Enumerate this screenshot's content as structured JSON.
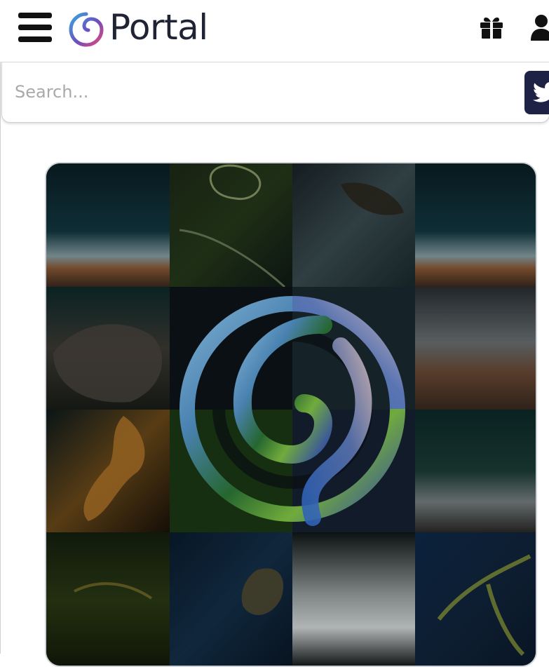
{
  "header": {
    "brand": "Portal",
    "menu_icon": "hamburger-menu-icon",
    "logo_icon": "portal-spiral-logo",
    "gift_icon": "gift-icon",
    "user_icon": "user-icon"
  },
  "search": {
    "placeholder": "Search...",
    "value": ""
  },
  "social": {
    "twitter_icon": "twitter-bird-icon"
  },
  "colors": {
    "brand_text": "#1f2333",
    "twitter_button": "#1e2244",
    "logo_gradient": [
      "#3aa0d8",
      "#7a4fb6",
      "#e0457b"
    ]
  }
}
